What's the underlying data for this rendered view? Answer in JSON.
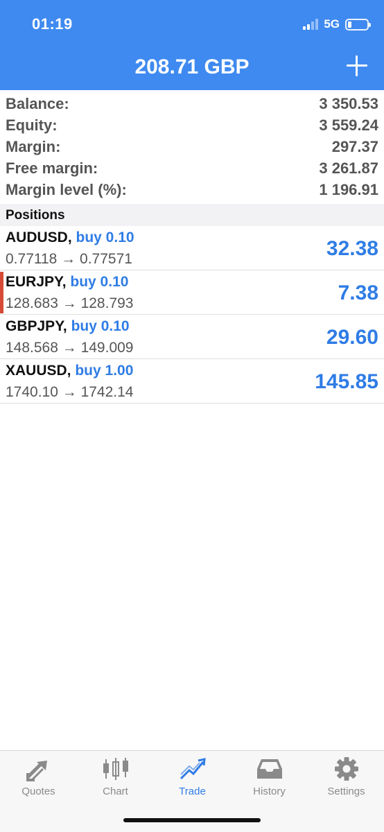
{
  "status_bar": {
    "time": "01:19",
    "network": "5G"
  },
  "header": {
    "title": "208.71 GBP",
    "add_icon": "plus-icon"
  },
  "summary": [
    {
      "label": "Balance:",
      "value": "3 350.53"
    },
    {
      "label": "Equity:",
      "value": "3 559.24"
    },
    {
      "label": "Margin:",
      "value": "297.37"
    },
    {
      "label": "Free margin:",
      "value": "3 261.87"
    },
    {
      "label": "Margin level (%):",
      "value": "1 196.91"
    }
  ],
  "positions_header": "Positions",
  "positions": [
    {
      "symbol": "AUDUSD,",
      "side": "buy 0.10",
      "prices": "0.77118 → 0.77571",
      "profit": "32.38"
    },
    {
      "symbol": "EURJPY,",
      "side": "buy 0.10",
      "prices": "128.683 → 128.793",
      "profit": "7.38"
    },
    {
      "symbol": "GBPJPY,",
      "side": "buy 0.10",
      "prices": "148.568 → 149.009",
      "profit": "29.60"
    },
    {
      "symbol": "XAUUSD,",
      "side": "buy 1.00",
      "prices": "1740.10 → 1742.14",
      "profit": "145.85"
    }
  ],
  "tabs": [
    {
      "label": "Quotes",
      "icon": "quotes-arrows-icon"
    },
    {
      "label": "Chart",
      "icon": "candlestick-icon"
    },
    {
      "label": "Trade",
      "icon": "trend-line-icon",
      "active": true
    },
    {
      "label": "History",
      "icon": "inbox-tray-icon"
    },
    {
      "label": "Settings",
      "icon": "gear-icon"
    }
  ],
  "colors": {
    "accent": "#3f8af0",
    "profit": "#2f7ce6",
    "marker": "#d64b36",
    "inactive_tab": "#8a8a8a"
  }
}
